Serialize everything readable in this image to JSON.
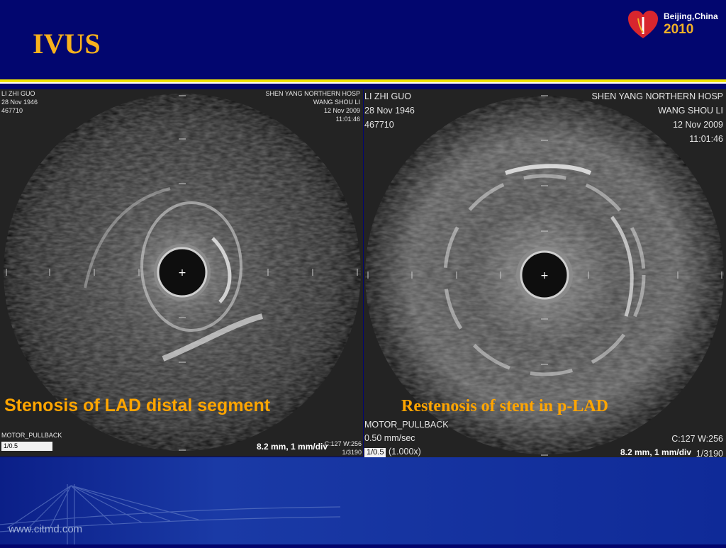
{
  "slide": {
    "title": "IVUS",
    "logo": {
      "line1": "Beijing,China",
      "line2": "2010"
    },
    "footer_url": "www.citmd.com"
  },
  "left_panel": {
    "patient_name": "LI   ZHI GUO",
    "dob": "28 Nov 1946",
    "id": "467710",
    "hospital": "SHEN YANG NORTHERN HOSP",
    "doctor": "WANG SHOU LI",
    "date": "12 Nov 2009",
    "time": "11:01:46",
    "mode": "MOTOR_PULLBACK",
    "scale": "8.2 mm, 1 mm/div",
    "cw": "C:127 W:256",
    "frame": "1/3190",
    "index": "1/0.5",
    "caption": "Stenosis of LAD distal segment"
  },
  "right_panel": {
    "patient_name": "LI   ZHI GUO",
    "dob": "28 Nov 1946",
    "id": "467710",
    "hospital": "SHEN YANG NORTHERN HOSP",
    "doctor": "WANG SHOU LI",
    "date": "12 Nov 2009",
    "time": "11:01:46",
    "mode": "MOTOR_PULLBACK",
    "speed": "0.50 mm/sec",
    "zoom": "(1.000x)",
    "scale": "8.2 mm, 1 mm/div",
    "cw": "C:127 W:256",
    "frame": "1/3190",
    "index": "1/0.5",
    "caption": "Restenosis of  stent in p-LAD"
  }
}
